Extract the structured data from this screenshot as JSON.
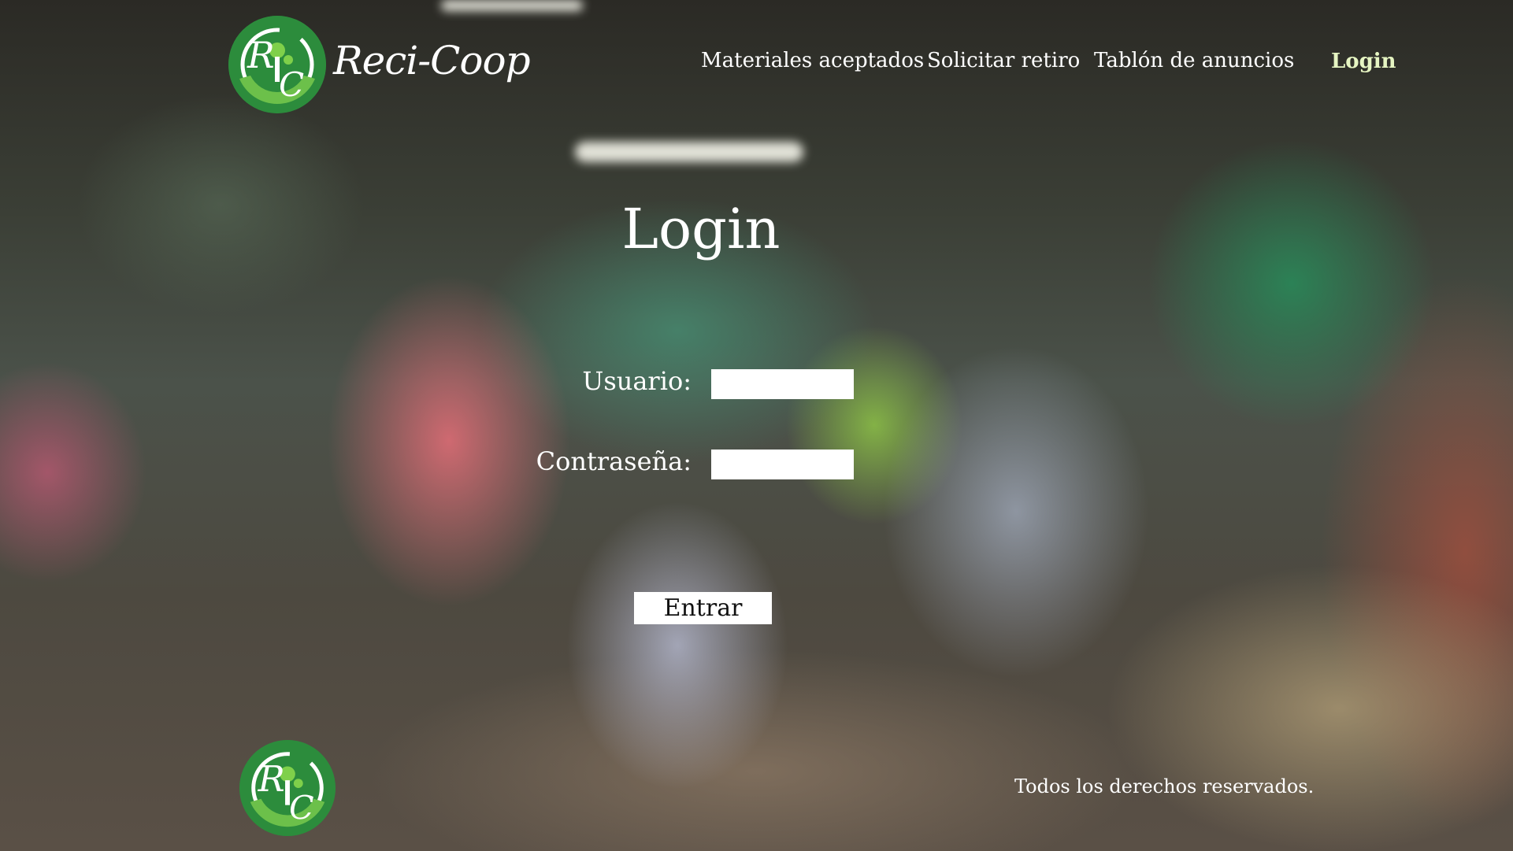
{
  "header": {
    "brand": "Reci-Coop",
    "logo_letters": "RC",
    "nav": {
      "materials": "Materiales aceptados",
      "pickup": "Solicitar retiro",
      "board": "Tablón de anuncios",
      "login": "Login"
    }
  },
  "login_form": {
    "title": "Login",
    "user_label": "Usuario:",
    "password_label": "Contraseña:",
    "user_value": "",
    "password_value": "",
    "submit_label": "Entrar"
  },
  "footer": {
    "rights": "Todos los derechos reservados.",
    "logo_letters": "RC"
  },
  "colors": {
    "brand_green": "#2c8c3c",
    "light_green": "#5cb84a",
    "login_link": "#e6f5c2"
  }
}
